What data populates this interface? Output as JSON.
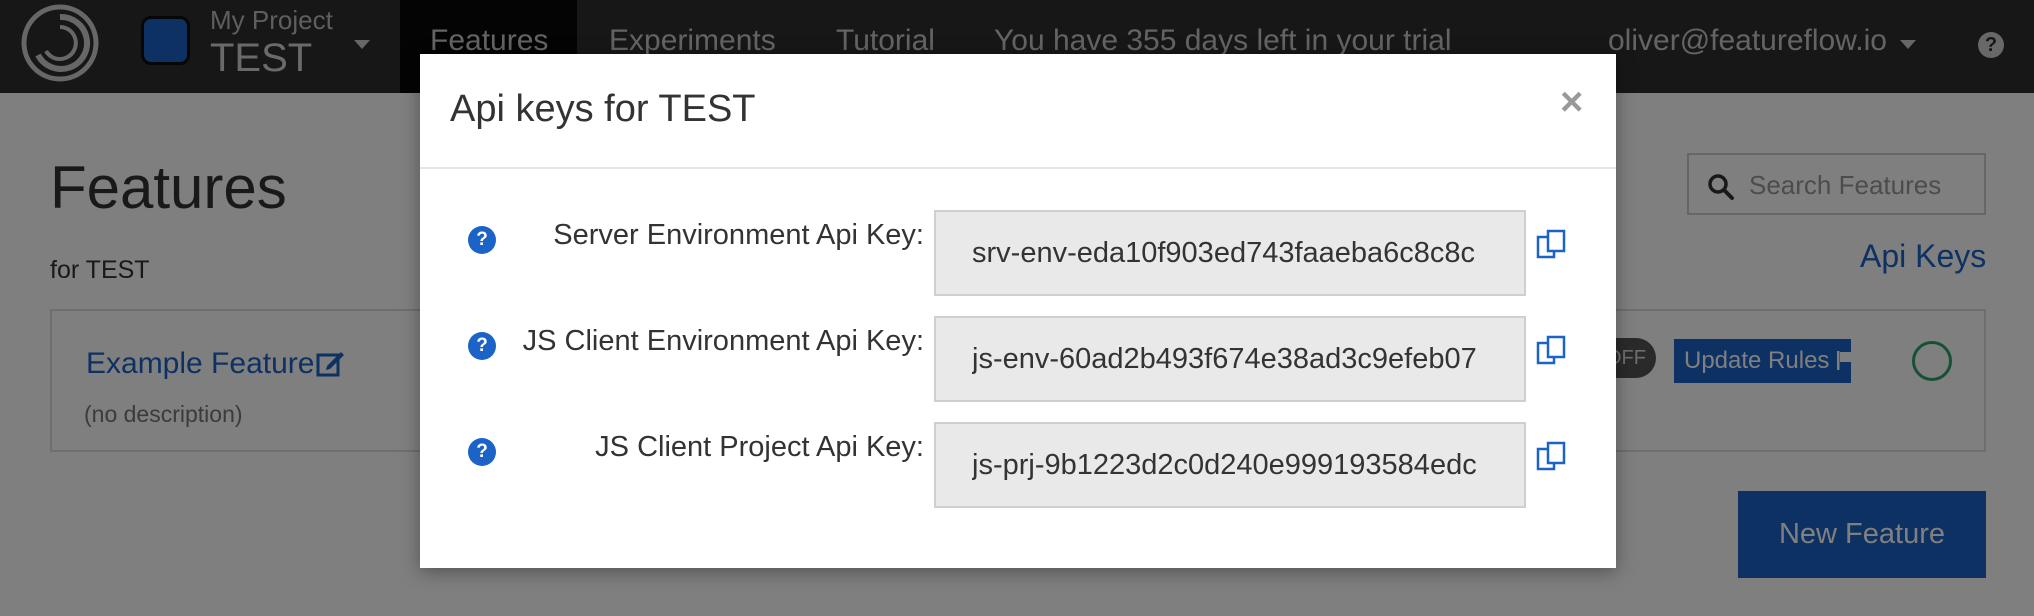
{
  "navbar": {
    "logo_icon": "featureflow-logo-icon",
    "project_label": "My Project",
    "project_name": "TEST",
    "project_color": "#1b63c6",
    "links": [
      {
        "label": "Features",
        "active": true
      },
      {
        "label": "Experiments",
        "active": false
      },
      {
        "label": "Tutorial",
        "active": false
      }
    ],
    "trial_text": "You have 355 days left in your trial",
    "user_email": "oliver@featureflow.io",
    "help_icon": "question-circle-icon"
  },
  "page": {
    "title": "Features",
    "subtitle": "for TEST",
    "search_placeholder": "Search Features",
    "api_keys_link": "Api Keys",
    "new_feature_button": "New Feature"
  },
  "feature_card": {
    "name": "Example Feature",
    "description": "(no description)",
    "toggle_label": "OFF",
    "update_rules_label": "Update Rules",
    "status_color": "#2aa56b"
  },
  "modal": {
    "title": "Api keys for TEST",
    "close_glyph": "×",
    "keys": [
      {
        "label": "Server Environment Api Key:",
        "value": "srv-env-eda10f903ed743faaeba6c8c8c"
      },
      {
        "label": "JS Client Environment Api Key:",
        "value": "js-env-60ad2b493f674e38ad3c9efeb07"
      },
      {
        "label": "JS Client Project Api Key:",
        "value": "js-prj-9b1223d2c0d240e999193584edc"
      }
    ]
  },
  "colors": {
    "accent": "#1b63c6",
    "navbar_bg": "#2e2e2e",
    "backdrop": "rgba(0,0,0,0.5)"
  }
}
